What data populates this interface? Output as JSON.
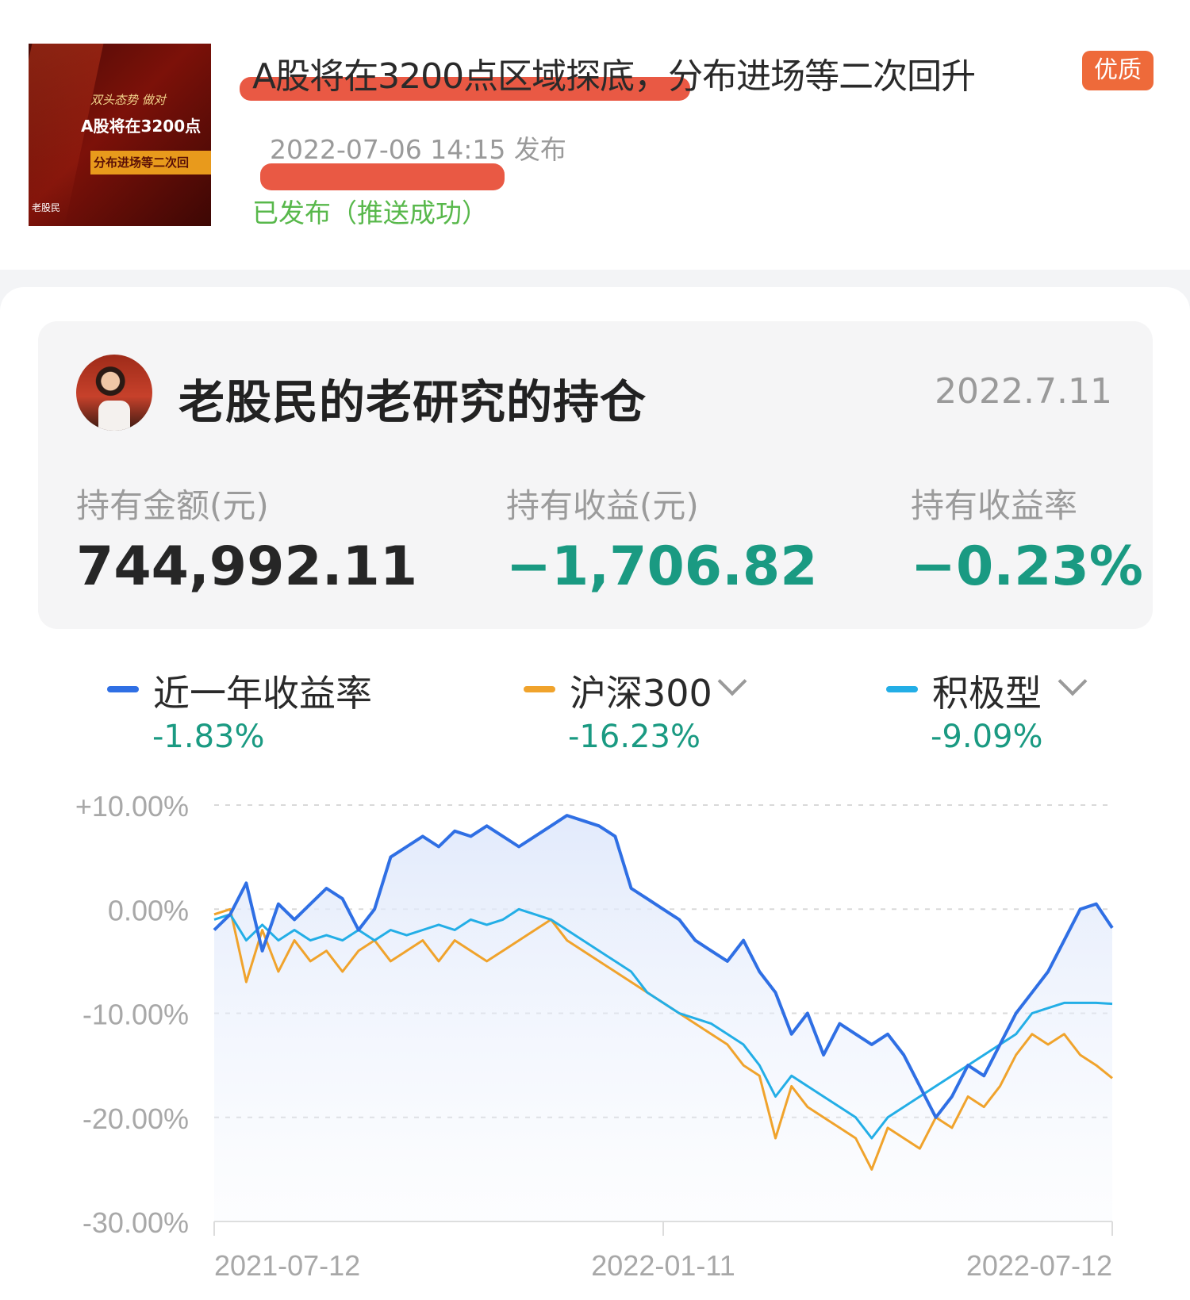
{
  "article": {
    "thumbnail": {
      "line1": "双头态势 做对",
      "line2": "A股将在3200点",
      "line3": "分布进场等二次回",
      "line4": "老股民"
    },
    "title": "A股将在3200点区域探底，分布进场等二次回升",
    "badge": "优质",
    "publish_time": "2022-07-06 14:15 发布",
    "status": "已发布（推送成功）"
  },
  "portfolio": {
    "title": "老股民的老研究的持仓",
    "date": "2022.7.11",
    "metrics": [
      {
        "label": "持有金额(元)",
        "value": "744,992.11"
      },
      {
        "label": "持有收益(元)",
        "value": "−1,706.82"
      },
      {
        "label": "持有收益率",
        "value": "−0.23%"
      }
    ]
  },
  "legend": [
    {
      "label": "近一年收益率",
      "value": "-1.83%",
      "color": "#2f6fe4",
      "dropdown": false
    },
    {
      "label": "沪深300",
      "value": "-16.23%",
      "color": "#f0a32c",
      "dropdown": true
    },
    {
      "label": "积极型",
      "value": "-9.09%",
      "color": "#23aee6",
      "dropdown": true
    }
  ],
  "colors": {
    "positive_negative_green": "#1a9a82",
    "grid": "#d9d9d9",
    "axis_text": "#a8a8a8"
  },
  "chart_data": {
    "type": "line",
    "y_ticks": [
      "+10.00%",
      "0.00%",
      "-10.00%",
      "-20.00%",
      "-30.00%"
    ],
    "ylim": [
      -30,
      10
    ],
    "x_ticks": [
      "2021-07-12",
      "2022-01-11",
      "2022-07-12"
    ],
    "grid": true,
    "series": [
      {
        "name": "近一年收益率",
        "color": "#2f6fe4",
        "values": [
          -2,
          -0.5,
          2.5,
          -4,
          0.5,
          -1,
          0.5,
          2,
          1,
          -2,
          0,
          5,
          6,
          7,
          6,
          7.5,
          7,
          8,
          7,
          6,
          7,
          8,
          9,
          8.5,
          8,
          7,
          2,
          1,
          0,
          -1,
          -3,
          -4,
          -5,
          -3,
          -6,
          -8,
          -12,
          -10,
          -14,
          -11,
          -12,
          -13,
          -12,
          -14,
          -17,
          -20,
          -18,
          -15,
          -16,
          -13,
          -10,
          -8,
          -6,
          -3,
          0,
          0.5,
          -1.8
        ]
      },
      {
        "name": "沪深300",
        "color": "#f0a32c",
        "values": [
          -0.5,
          0,
          -7,
          -2,
          -6,
          -3,
          -5,
          -4,
          -6,
          -4,
          -3,
          -5,
          -4,
          -3,
          -5,
          -3,
          -4,
          -5,
          -4,
          -3,
          -2,
          -1,
          -3,
          -4,
          -5,
          -6,
          -7,
          -8,
          -9,
          -10,
          -11,
          -12,
          -13,
          -15,
          -16,
          -22,
          -17,
          -19,
          -20,
          -21,
          -22,
          -25,
          -21,
          -22,
          -23,
          -20,
          -21,
          -18,
          -19,
          -17,
          -14,
          -12,
          -13,
          -12,
          -14,
          -15,
          -16.23
        ]
      },
      {
        "name": "积极型",
        "color": "#23aee6",
        "values": [
          -1,
          -0.5,
          -3,
          -1.5,
          -3,
          -2,
          -3,
          -2.5,
          -3,
          -2,
          -3,
          -2,
          -2.5,
          -2,
          -1.5,
          -2,
          -1,
          -1.5,
          -1,
          0,
          -0.5,
          -1,
          -2,
          -3,
          -4,
          -5,
          -6,
          -8,
          -9,
          -10,
          -10.5,
          -11,
          -12,
          -13,
          -15,
          -18,
          -16,
          -17,
          -18,
          -19,
          -20,
          -22,
          -20,
          -19,
          -18,
          -17,
          -16,
          -15,
          -14,
          -13,
          -12,
          -10,
          -9.5,
          -9,
          -9,
          -9,
          -9.09
        ]
      }
    ]
  }
}
